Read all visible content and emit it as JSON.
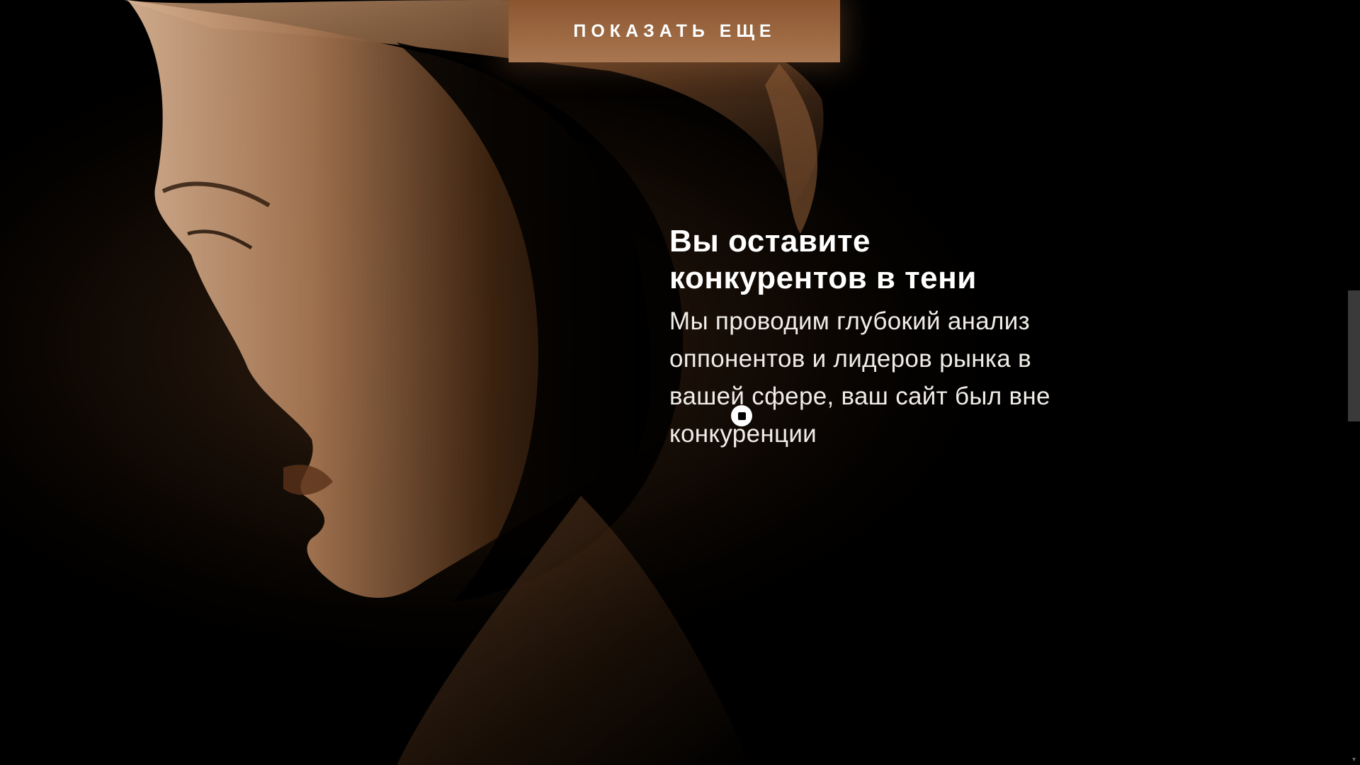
{
  "cta": {
    "show_more_label": "ПОКАЗАТЬ ЕЩЕ"
  },
  "section": {
    "title_line1": "Вы оставите",
    "title_line2": "конкурентов в тени",
    "text": "Мы проводим глубокий анализ оппонентов и лидеров рынка в вашей сфере, ваш сайт был вне конкуренции"
  },
  "colors": {
    "background": "#000000",
    "accent_bronze": "#9d6a44",
    "text": "#ffffff"
  },
  "icons": {
    "cursor": "cursor-icon",
    "scroll_down": "chevron-down-icon"
  }
}
